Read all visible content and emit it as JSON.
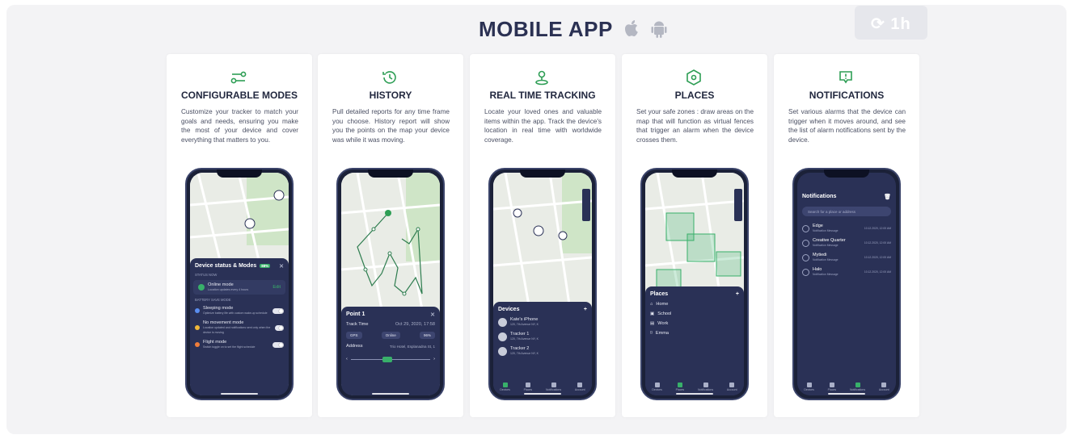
{
  "header": {
    "title": "MOBILE APP",
    "apple_icon": "apple-icon",
    "android_icon": "android-icon",
    "corner_badge": "1h"
  },
  "colors": {
    "accent_green": "#2e9e55",
    "navy": "#2a3156",
    "title": "#2b3153"
  },
  "cards": [
    {
      "icon": "sliders-icon",
      "title": "CONFIGURABLE MODES",
      "description": "Customize your tracker to match your goals and needs, ensuring you make the most of your device and cover everything that matters to you.",
      "screen": {
        "panel_title": "Device status & Modes",
        "panel_badge": "88%",
        "status_label": "STATUS NOW",
        "online_mode": "Online mode",
        "online_sub": "Location updates every 4 hours",
        "edit": "Edit",
        "battery_label": "BATTERY SAVE MODE",
        "modes": [
          {
            "name": "Sleeping mode",
            "sub": "Optimize battery life with custom wake-up schedule"
          },
          {
            "name": "No movement mode",
            "sub": "Location updated and notifications sent only when the device is moving"
          },
          {
            "name": "Flight mode",
            "sub": "Switch toggle on to set the flight schedule"
          }
        ]
      }
    },
    {
      "icon": "history-icon",
      "title": "HISTORY",
      "description": "Pull detailed reports for any time frame you choose. History report will show you the points on the map your device was while it was moving.",
      "screen": {
        "panel_title": "Point 1",
        "track_time_label": "Track Time",
        "track_time_value": "Oct 29, 2020, 17:58",
        "chips": [
          "GPS",
          "Online",
          "96%"
        ],
        "address_label": "Address",
        "address_value": "Trio Hotel, Esplanadna St, 1"
      }
    },
    {
      "icon": "location-person-icon",
      "title": "REAL TIME TRACKING",
      "description": "Locate your loved ones and valuable items within the app. Track the device's location in real time with worldwide coverage.",
      "screen": {
        "panel_title": "Devices",
        "devices": [
          {
            "name": "Kate's iPhone",
            "sub": "120, 7th Avenue NY, K"
          },
          {
            "name": "Tracker 1",
            "sub": "120, 7th Avenue NY, K"
          },
          {
            "name": "Tracker 2",
            "sub": "120, 7th Avenue NY, K"
          }
        ],
        "nav": [
          "Devices",
          "Places",
          "Notifications",
          "Account"
        ]
      }
    },
    {
      "icon": "place-icon",
      "title": "PLACES",
      "description": "Set your safe zones : draw areas on the map that will function as virtual fences that trigger an alarm when the device crosses them.",
      "screen": {
        "panel_title": "Places",
        "places": [
          "Home",
          "School",
          "Work",
          "Emma"
        ],
        "nav": [
          "Devices",
          "Places",
          "Notifications",
          "Account"
        ]
      }
    },
    {
      "icon": "alert-icon",
      "title": "NOTIFICATIONS",
      "description": "Set various alarms that the device can trigger when it moves around, and see the list of alarm notifications sent by the device.",
      "screen": {
        "panel_title": "Notifications",
        "search_placeholder": "Search for a place or address",
        "items": [
          {
            "name": "Edge",
            "sub": "Notification Message",
            "time": "10.12.2020, 12:00 AM"
          },
          {
            "name": "Creative Quarter",
            "sub": "Notification Message",
            "time": "10.12.2020, 12:00 AM"
          },
          {
            "name": "Mytiedi",
            "sub": "Notification Message",
            "time": "10.12.2020, 12:00 AM"
          },
          {
            "name": "Halo",
            "sub": "Notification Message",
            "time": "10.12.2020, 12:00 AM"
          }
        ],
        "nav": [
          "Devices",
          "Places",
          "Notifications",
          "Account"
        ]
      }
    }
  ]
}
